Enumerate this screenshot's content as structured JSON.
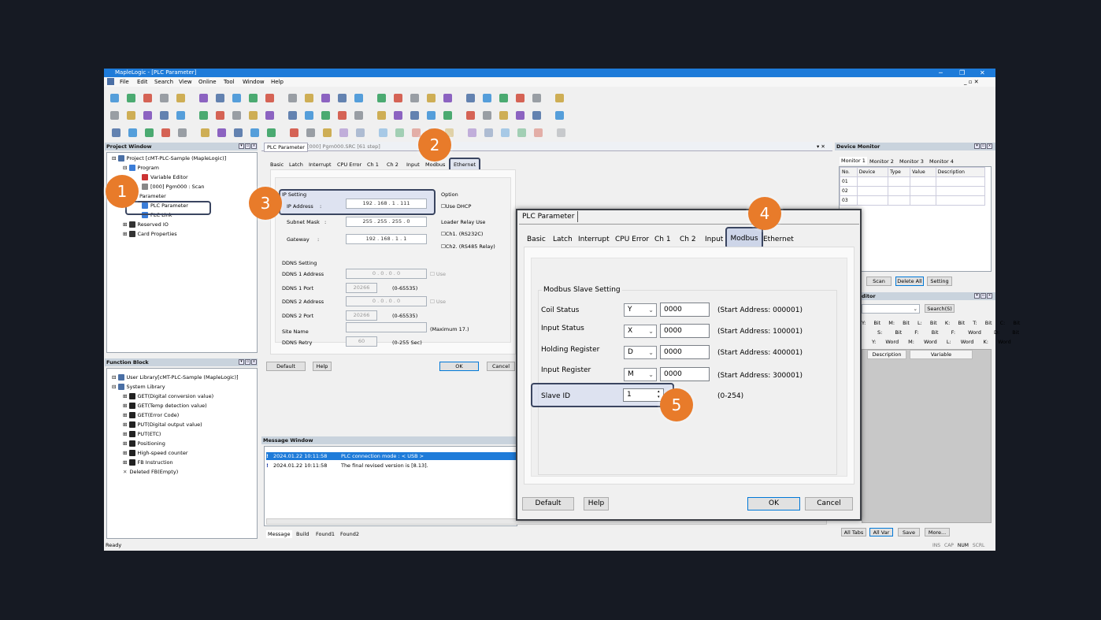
{
  "app": {
    "title": "MapleLogic - [PLC Parameter]"
  },
  "menu": [
    "File",
    "Edit",
    "Search",
    "View",
    "Online",
    "Tool",
    "Window",
    "Help"
  ],
  "project_window": {
    "title": "Project Window",
    "items": [
      "Project [cMT-PLC-Sample (MapleLogic)]",
      "Program",
      "Variable Editor",
      "[000] Pgm000 : Scan",
      "Parameter",
      "PLC Parameter",
      "PLC Link",
      "Reserved IO",
      "Card Properties"
    ]
  },
  "function_block": {
    "title": "Function Block",
    "items": [
      "User Library[cMT-PLC-Sample (MapleLogic)]",
      "System Library",
      "GET(Digital conversion value)",
      "GET(Temp detection value)",
      "GET(Error Code)",
      "PUT(Digital output value)",
      "PUT(ETC)",
      "Positioning",
      "High-speed counter",
      "FB Instruction",
      "Deleted FB(Empty)"
    ]
  },
  "doc_tab": {
    "label": "PLC Parameter",
    "label2": "[000] Pgm000.SRC [61 step]"
  },
  "param": {
    "tabs": [
      "Basic",
      "Latch",
      "Interrupt",
      "CPU Error",
      "Ch 1",
      "Ch 2",
      "Input",
      "Modbus",
      "Ethernet"
    ],
    "ip_setting": "IP Setting",
    "ip_label": "IP Address",
    "ip": [
      "192",
      "168",
      "1",
      "111"
    ],
    "subnet_label": "Subnet Mask",
    "subnet": [
      "255",
      "255",
      "255",
      "0"
    ],
    "gateway_label": "Gateway",
    "gateway": [
      "192",
      "168",
      "1",
      "1"
    ],
    "option": "Option",
    "use_dhcp": "Use DHCP",
    "loader_relay": "Loader Relay Use",
    "ch1": "Ch1. (RS232C)",
    "ch2": "Ch2. (RS485 Relay)",
    "ddns_setting": "DDNS Setting",
    "ddns1_addr": "DDNS 1 Address",
    "ddns1_port": "DDNS 1 Port",
    "ddns2_addr": "DDNS 2 Address",
    "ddns2_port": "DDNS 2 Port",
    "zero": "0",
    "use": "Use",
    "port_val": "20266",
    "port_range": "(0-65535)",
    "site_name": "Site Name",
    "site_max": "(Maximum 17.)",
    "ddns_retry": "DDNS Retry",
    "retry_val": "60",
    "retry_range": "(0-255 Sec)",
    "default": "Default",
    "help": "Help",
    "ok": "OK",
    "cancel": "Cancel"
  },
  "messages": {
    "title": "Message Window",
    "rows": [
      {
        "time": "2024.01.22 10:11:58",
        "text": "PLC connection mode : < USB >"
      },
      {
        "time": "2024.01.22 10:11:58",
        "text": "The final revised version is [8.13]."
      }
    ],
    "tabs": [
      "Message",
      "Build",
      "Found1",
      "Found2"
    ]
  },
  "device_monitor": {
    "title": "Device Monitor",
    "tabs": [
      "Monitor 1",
      "Monitor 2",
      "Monitor 3",
      "Monitor 4"
    ],
    "cols": [
      "No.",
      "Device",
      "Type",
      "Value",
      "Description"
    ],
    "rows": [
      "01",
      "02",
      "03"
    ],
    "buttons": [
      "Scan",
      "Delete All",
      "Setting"
    ]
  },
  "editor": {
    "title": "ditor",
    "search": "Search(S)",
    "types1": [
      "Y: Bit",
      "M: Bit",
      "L: Bit",
      "K: Bit",
      "T: Bit",
      "C: Bit"
    ],
    "types2": [
      "S: Bit",
      "F: Bit",
      "F: Word",
      "D: Bit"
    ],
    "types3": [
      "Y: Word",
      "M: Word",
      "L: Word",
      "K: Word"
    ],
    "cols": [
      "Description",
      "Variable"
    ],
    "buttons": [
      "All Tabs",
      "All Var",
      "Save",
      "More..."
    ]
  },
  "status": {
    "ready": "Ready",
    "flags": [
      "INS",
      "CAP",
      "NUM",
      "SCRL"
    ]
  },
  "modbus_dialog": {
    "title": "PLC Parameter",
    "tabs": [
      "Basic",
      "Latch",
      "Interrupt",
      "CPU Error",
      "Ch 1",
      "Ch 2",
      "Input",
      "Modbus",
      "Ethernet"
    ],
    "group": "Modbus Slave Setting",
    "rows": [
      {
        "label": "Coil Status",
        "type": "Y",
        "value": "0000",
        "note": "(Start Address: 000001)"
      },
      {
        "label": "Input Status",
        "type": "X",
        "value": "0000",
        "note": "(Start Address: 100001)"
      },
      {
        "label": "Holding Register",
        "type": "D",
        "value": "0000",
        "note": "(Start Address: 400001)"
      },
      {
        "label": "Input Register",
        "type": "M",
        "value": "0000",
        "note": "(Start Address: 300001)"
      }
    ],
    "slave_label": "Slave ID",
    "slave_value": "1",
    "slave_range": "(0-254)",
    "default": "Default",
    "help": "Help",
    "ok": "OK",
    "cancel": "Cancel"
  },
  "callouts": [
    "1",
    "2",
    "3",
    "4",
    "5"
  ],
  "colors": {
    "accent": "#1e7bd9",
    "callout": "#e87b2a",
    "highlight": "#3a4560"
  }
}
